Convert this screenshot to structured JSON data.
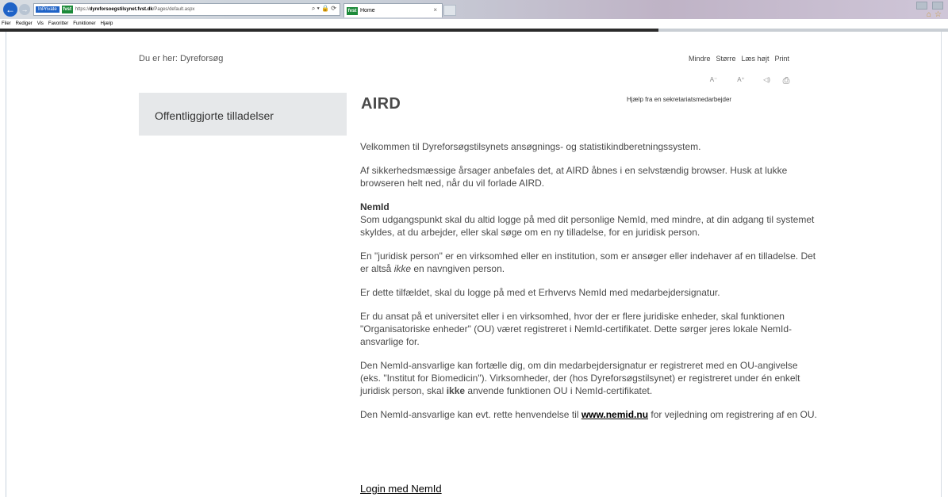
{
  "browser": {
    "inprivate_label": "InPrivate",
    "url_prefix": "https://",
    "url_host": "dyreforsoegstilsynet.fvst.dk",
    "url_path": "/Pages/default.aspx",
    "addr_icons": "⌕ ▾ 🔒 ⟳",
    "tab_title": "Home",
    "tab_close": "×",
    "favicon": "fvst",
    "menu": [
      "Filer",
      "Rediger",
      "Vis",
      "Favoritter",
      "Funktioner",
      "Hjælp"
    ]
  },
  "page": {
    "breadcrumb": "Du er her: Dyreforsøg",
    "toolbar": {
      "smaller": "Mindre",
      "larger": "Større",
      "read_aloud": "Læs højt",
      "print": "Print",
      "icon_smaller": "A⁻",
      "icon_larger": "A⁺",
      "icon_read": "◁)",
      "icon_print": "⎙"
    },
    "sidebar_link": "Offentliggjorte tilladelser",
    "title": "AIRD",
    "help_text": "Hjælp fra en sekretariatsmedarbejder",
    "intro": "Velkommen til Dyreforsøgstilsynets ansøgnings- og statistikindberetningssystem.",
    "para2": "Af sikkerhedsmæssige årsager anbefales det, at AIRD åbnes i en selvstændig browser. Husk at lukke browseren helt ned, når du vil forlade AIRD.",
    "nemid_heading": "NemId",
    "para3": "Som udgangspunkt skal du altid logge på med dit personlige NemId, med mindre, at din adgang til systemet skyldes, at du arbejder, eller skal søge om en ny tilladelse, for en juridisk person.",
    "para4_a": "En \"juridisk person\" er en virksomhed eller en institution, som er ansøger eller indehaver af en tilladelse. Det er altså ",
    "para4_em": "ikke",
    "para4_b": " en navngiven person.",
    "para5": "Er dette tilfældet, skal du logge på med et Erhvervs NemId med medarbejdersignatur.",
    "para6": "Er du ansat på et universitet eller i en virksomhed, hvor der er flere juridiske enheder, skal funktionen \"Organisatoriske enheder\" (OU) været registreret i NemId-certifikatet. Dette sørger jeres lokale NemId-ansvarlige for.",
    "para7_a": "Den NemId-ansvarlige kan fortælle dig, om din medarbejdersignatur er registreret med en OU-angivelse (eks. \"Institut for Biomedicin\"). Virksomheder, der (hos Dyreforsøgstilsynet) er registreret under én enkelt juridisk person, skal ",
    "para7_bold": "ikke",
    "para7_b": " anvende funktionen OU i NemId-certifikatet.",
    "para8_a": "Den NemId-ansvarlige kan evt. rette henvendelse til ",
    "para8_link": "www.nemid.nu",
    "para8_b": " for vejledning om registrering af en OU.",
    "login_link": "Login med NemId"
  }
}
